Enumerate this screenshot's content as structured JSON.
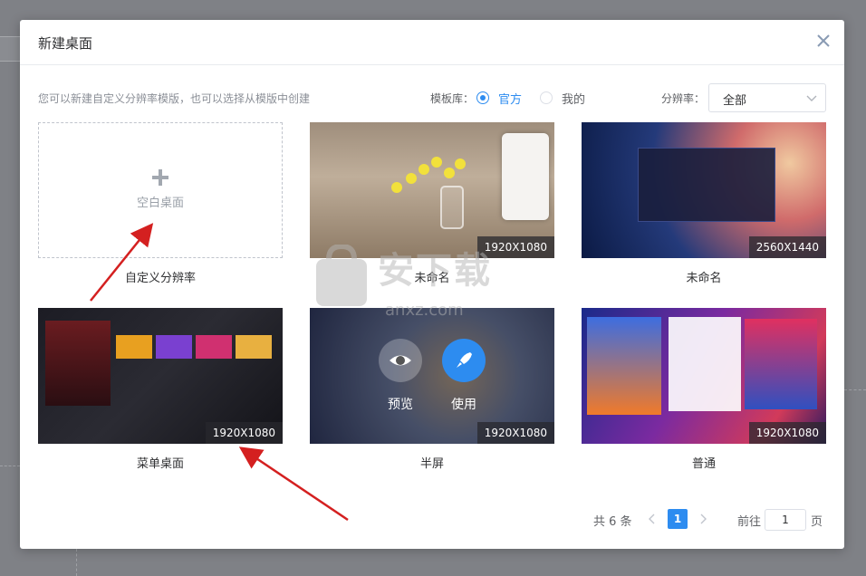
{
  "dialog": {
    "title": "新建桌面",
    "close_icon": "close-icon",
    "hint": "您可以新建自定义分辨率模版，也可以选择从模版中创建",
    "repo_label": "模板库：",
    "repo_options": [
      {
        "label": "官方",
        "selected": true
      },
      {
        "label": "我的",
        "selected": false
      }
    ],
    "resolution_label": "分辨率：",
    "resolution_value": "全部"
  },
  "cards": [
    {
      "caption": "自定义分辨率",
      "blank_label": "空白桌面",
      "icon": "plus-icon"
    },
    {
      "caption": "未命名",
      "resolution": "1920X1080"
    },
    {
      "caption": "未命名",
      "resolution": "2560X1440"
    },
    {
      "caption": "菜单桌面",
      "resolution": "1920X1080"
    },
    {
      "caption": "半屏",
      "resolution": "1920X1080",
      "overlay": {
        "preview": "预览",
        "use": "使用"
      }
    },
    {
      "caption": "普通",
      "resolution": "1920X1080"
    }
  ],
  "pagination": {
    "total": "共 6 条",
    "current_page": "1",
    "goto_label": "前往",
    "goto_value": "1",
    "unit": "页"
  },
  "watermark": {
    "text": "安下载",
    "sub": "anxz.com"
  },
  "colors": {
    "accent": "#2d8cf0",
    "annotation_arrow": "#d42020"
  }
}
